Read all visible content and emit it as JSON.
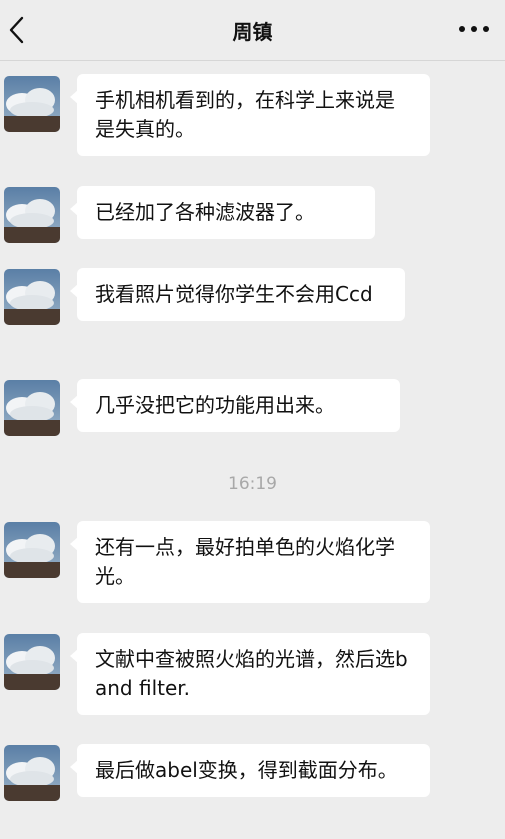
{
  "header": {
    "title": "周镇",
    "back_icon": "chevron-left-icon",
    "more_icon": "more-horizontal-icon"
  },
  "messages_before": [
    "手机相机看到的，在科学上来说是是失真的。",
    "已经加了各种滤波器了。",
    "我看照片觉得你学生不会用Ccd",
    "几乎没把它的功能用出来。"
  ],
  "timestamp": "16:19",
  "messages_after": [
    "还有一点，最好拍单色的火焰化学光。",
    "文献中查被照火焰的光谱，然后选band filter.",
    "最后做abel变换，得到截面分布。"
  ],
  "colors": {
    "background": "#ededed",
    "bubble": "#ffffff",
    "timestamp": "#a8a8a8"
  }
}
